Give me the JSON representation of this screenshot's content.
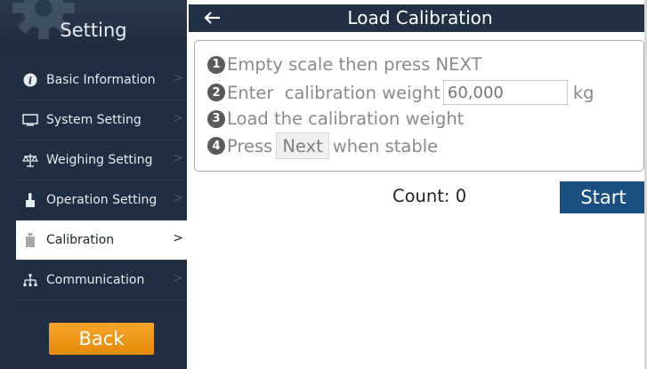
{
  "sidebar": {
    "title": "Setting",
    "items": [
      {
        "label": "Basic Information",
        "icon": "info-icon",
        "active": false
      },
      {
        "label": "System Setting",
        "icon": "monitor-icon",
        "active": false
      },
      {
        "label": "Weighing Setting",
        "icon": "balance-scale-icon",
        "active": false
      },
      {
        "label": "Operation Setting",
        "icon": "hand-pointer-icon",
        "active": false
      },
      {
        "label": "Calibration",
        "icon": "weight-icon",
        "active": true
      },
      {
        "label": "Communication",
        "icon": "network-icon",
        "active": false
      }
    ],
    "chevron": ">",
    "back_label": "Back",
    "back_color": "#f29a1d"
  },
  "header": {
    "back_icon": "arrow-left-icon",
    "title": "Load Calibration"
  },
  "steps": {
    "step1": {
      "num": "1",
      "text": "Empty scale then press NEXT"
    },
    "step2": {
      "num": "2",
      "text": "Enter  calibration weight",
      "placeholder": "60,000",
      "unit": "kg"
    },
    "step3": {
      "num": "3",
      "text": "Load the calibration weight"
    },
    "step4": {
      "num": "4",
      "text_before": "Press",
      "button": "Next",
      "text_after": "when stable"
    }
  },
  "count": {
    "label": "Count:",
    "value": "0"
  },
  "start_label": "Start",
  "colors": {
    "sidebar_bg": "#1f2e40",
    "header_bg": "#223046",
    "start_bg": "#1b4f82",
    "back_bg": "#f29a1d"
  }
}
